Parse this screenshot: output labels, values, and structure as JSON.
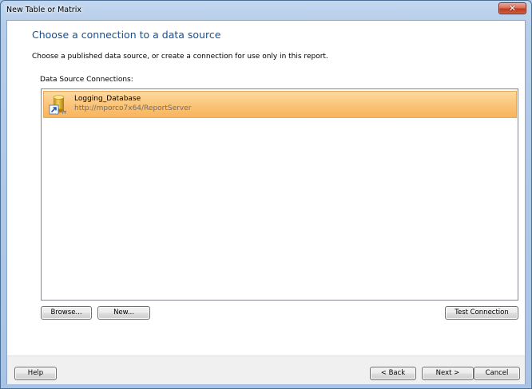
{
  "window": {
    "title": "New Table or Matrix",
    "close_glyph": "✕"
  },
  "page": {
    "title": "Choose a connection to a data source",
    "description": "Choose a published data source, or create a connection for use only in this report.",
    "connections_label": "Data Source Connections:"
  },
  "connections": [
    {
      "name": "Logging_Database",
      "url": "http://mporco7x64/ReportServer",
      "icon": "shared-datasource-icon",
      "selected": true
    }
  ],
  "buttons": {
    "browse": "Browse...",
    "new": "New...",
    "test_connection": "Test Connection",
    "help": "Help",
    "back": "< Back",
    "next": "Next >",
    "cancel": "Cancel"
  },
  "colors": {
    "title_accent": "#1b4f8f",
    "selection": "#fbc57a"
  }
}
